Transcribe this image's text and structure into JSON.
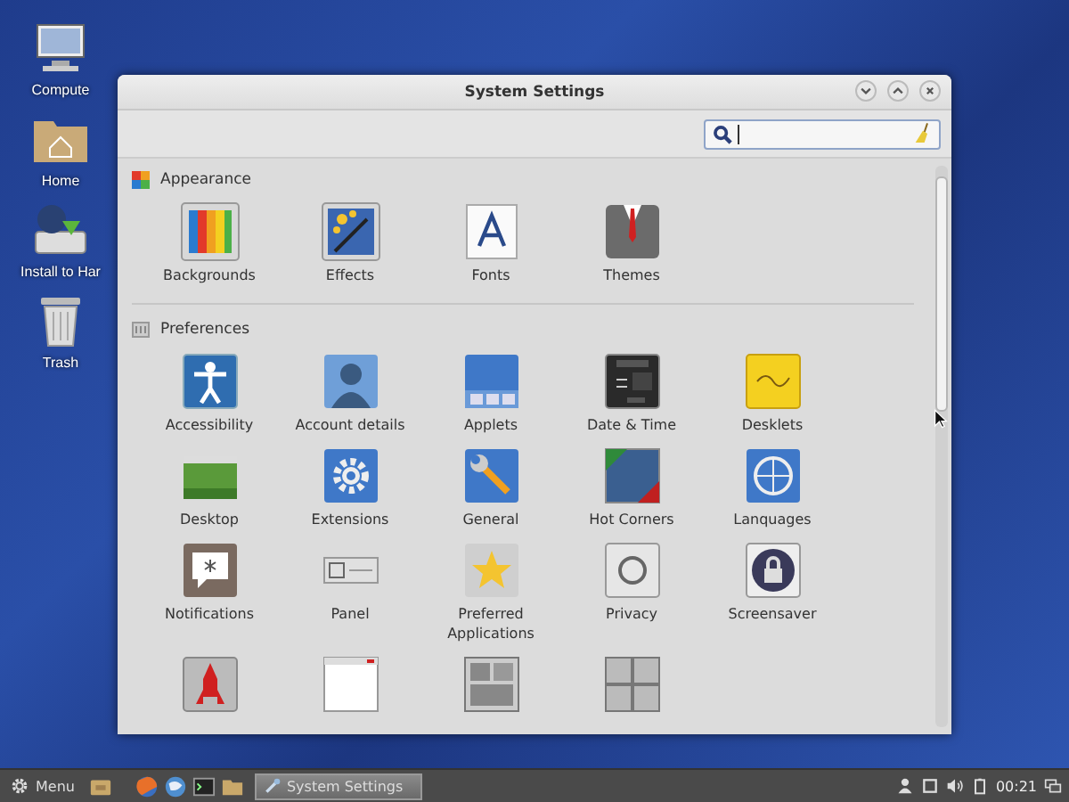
{
  "desktop_icons": [
    {
      "label": "Compute"
    },
    {
      "label": "Home"
    },
    {
      "label": "Install to Har"
    },
    {
      "label": "Trash"
    }
  ],
  "window": {
    "title": "System Settings",
    "sections": [
      {
        "title": "Appearance",
        "items": [
          {
            "kind": "labeled",
            "label": "Backgrounds"
          },
          {
            "kind": "labeled",
            "label": "Effects"
          },
          {
            "kind": "labeled",
            "label": "Fonts"
          },
          {
            "kind": "labeled",
            "label": "Themes"
          }
        ]
      },
      {
        "title": "Preferences",
        "items": [
          {
            "kind": "labeled",
            "label": "Accessibility"
          },
          {
            "kind": "labeled",
            "label": "Account details"
          },
          {
            "kind": "labeled",
            "label": "Applets"
          },
          {
            "kind": "labeled",
            "label": "Date & Time"
          },
          {
            "kind": "labeled",
            "label": "Desklets"
          },
          {
            "kind": "labeled",
            "label": "Desktop"
          },
          {
            "kind": "labeled",
            "label": "Extensions"
          },
          {
            "kind": "labeled",
            "label": "General"
          },
          {
            "kind": "labeled",
            "label": "Hot Corners"
          },
          {
            "kind": "labeled",
            "label": "Lanquages"
          },
          {
            "kind": "labeled",
            "label": "Notifications"
          },
          {
            "kind": "labeled",
            "label": "Panel"
          },
          {
            "kind": "labeled",
            "label": "Preferred Applications"
          },
          {
            "kind": "labeled",
            "label": "Privacy"
          },
          {
            "kind": "labeled",
            "label": "Screensaver"
          },
          {
            "kind": "clipped"
          },
          {
            "kind": "clipped"
          },
          {
            "kind": "clipped"
          },
          {
            "kind": "clipped"
          }
        ]
      }
    ]
  },
  "taskbar": {
    "menu": "Menu",
    "tasks": [
      {
        "label": "System Settings",
        "selected": true
      }
    ],
    "clock": "00:21"
  }
}
